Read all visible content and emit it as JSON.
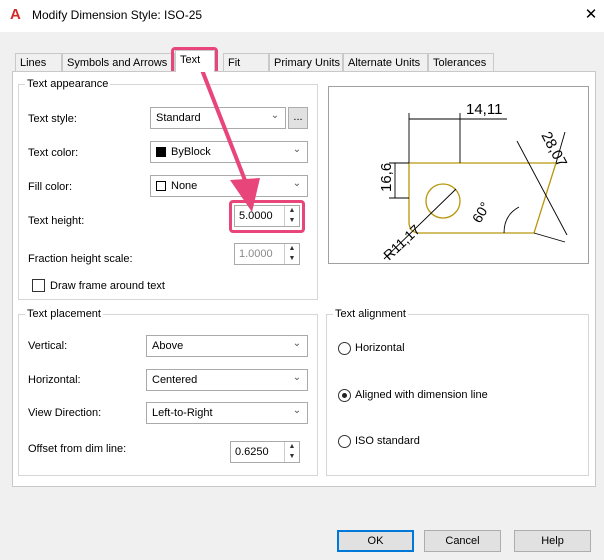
{
  "window": {
    "title": "Modify Dimension Style: ISO-25",
    "close_glyph": "✕",
    "app_glyph": "A"
  },
  "tabs": [
    {
      "label": "Lines"
    },
    {
      "label": "Symbols and Arrows"
    },
    {
      "label": "Text",
      "active": true
    },
    {
      "label": "Fit"
    },
    {
      "label": "Primary Units"
    },
    {
      "label": "Alternate Units"
    },
    {
      "label": "Tolerances"
    }
  ],
  "text_appearance": {
    "legend": "Text appearance",
    "text_style": {
      "label": "Text style:",
      "value": "Standard",
      "browse": "..."
    },
    "text_color": {
      "label": "Text color:",
      "value": "ByBlock"
    },
    "fill_color": {
      "label": "Fill color:",
      "value": "None"
    },
    "text_height": {
      "label": "Text height:",
      "value": "5.0000"
    },
    "fraction_height_scale": {
      "label": "Fraction height scale:",
      "value": "1.0000"
    },
    "draw_frame": {
      "label": "Draw frame around text",
      "checked": false
    }
  },
  "preview": {
    "dim_top": "14,11",
    "dim_left": "16,6",
    "dim_right": "28,07",
    "dim_angle": "60°",
    "dim_radius": "R11,17"
  },
  "text_placement": {
    "legend": "Text placement",
    "vertical": {
      "label": "Vertical:",
      "value": "Above"
    },
    "horizontal": {
      "label": "Horizontal:",
      "value": "Centered"
    },
    "view_direction": {
      "label": "View Direction:",
      "value": "Left-to-Right"
    },
    "offset": {
      "label": "Offset from dim line:",
      "value": "0.6250"
    }
  },
  "text_alignment": {
    "legend": "Text alignment",
    "options": [
      {
        "label": "Horizontal",
        "selected": false
      },
      {
        "label": "Aligned with dimension line",
        "selected": true
      },
      {
        "label": "ISO standard",
        "selected": false
      }
    ]
  },
  "buttons": {
    "ok": "OK",
    "cancel": "Cancel",
    "help": "Help"
  },
  "colors": {
    "highlight": "#e8457a",
    "preview_geometry": "#b8960c",
    "accent": "#0078d7"
  }
}
